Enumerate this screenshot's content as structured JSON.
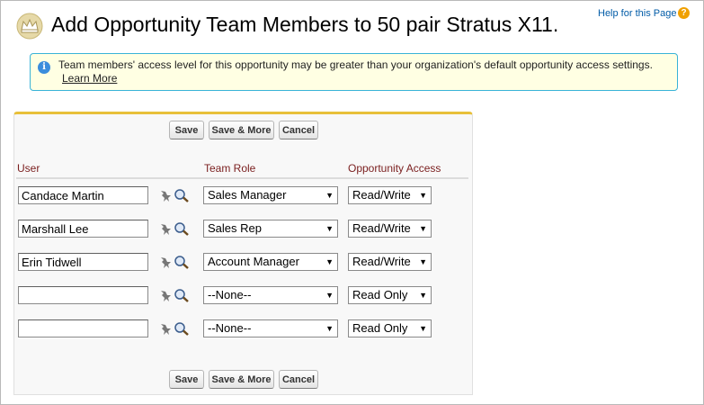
{
  "header": {
    "title": "Add Opportunity Team Members to 50 pair Stratus X11.",
    "help_link": "Help for this Page",
    "help_icon": "question-icon"
  },
  "info": {
    "message": "Team members' access level for this opportunity may be greater than your organization's default opportunity access settings.",
    "learn_more": "Learn More",
    "icon": "info-icon"
  },
  "buttons": {
    "save": "Save",
    "save_more": "Save & More",
    "cancel": "Cancel"
  },
  "columns": {
    "user": "User",
    "role": "Team Role",
    "access": "Opportunity Access"
  },
  "rows": [
    {
      "user": "Candace Martin",
      "role": "Sales Manager",
      "access": "Read/Write"
    },
    {
      "user": "Marshall Lee",
      "role": "Sales Rep",
      "access": "Read/Write"
    },
    {
      "user": "Erin Tidwell",
      "role": "Account Manager",
      "access": "Read/Write"
    },
    {
      "user": "",
      "role": "--None--",
      "access": "Read Only"
    },
    {
      "user": "",
      "role": "--None--",
      "access": "Read Only"
    }
  ],
  "colors": {
    "accent_border": "#e8c03a",
    "link": "#015ba7",
    "column_header": "#7a1e1e",
    "banner_bg": "#ffffe3",
    "banner_border": "#39b3d7"
  }
}
